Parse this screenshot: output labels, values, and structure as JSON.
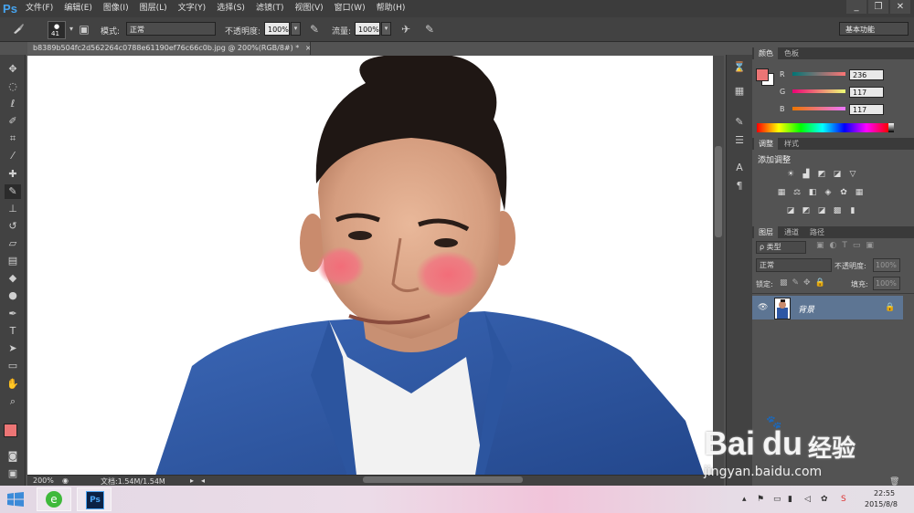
{
  "app": {
    "logo": "Ps"
  },
  "menu": [
    "文件(F)",
    "编辑(E)",
    "图像(I)",
    "图层(L)",
    "文字(Y)",
    "选择(S)",
    "滤镜(T)",
    "视图(V)",
    "窗口(W)",
    "帮助(H)"
  ],
  "window_controls": [
    "_",
    "❐",
    "✕"
  ],
  "options": {
    "brush_size": "41",
    "mode_label": "模式:",
    "mode_value": "正常",
    "opacity_label": "不透明度:",
    "opacity_value": "100%",
    "flow_label": "流量:",
    "flow_value": "100%",
    "workspace": "基本功能"
  },
  "document": {
    "tab_title": "b8389b504fc2d562264c0788e61190ef76c66c0b.jpg @ 200%(RGB/8#) *",
    "close": "×"
  },
  "status": {
    "zoom": "200%",
    "doc_info": "文档:1.54M/1.54M"
  },
  "color_panel": {
    "tabs": [
      "颜色",
      "色板"
    ],
    "r_label": "R",
    "g_label": "G",
    "b_label": "B",
    "r": "236",
    "g": "117",
    "b": "117",
    "foreground": "#ec7575",
    "background": "#ffffff"
  },
  "adjust_panel": {
    "tabs": [
      "调整",
      "样式"
    ],
    "title": "添加调整"
  },
  "layers_panel": {
    "tabs": [
      "图层",
      "通道",
      "路径"
    ],
    "filter_label": "ρ 类型",
    "blend_mode": "正常",
    "opacity_label": "不透明度:",
    "opacity_value": "100%",
    "lock_label": "锁定:",
    "fill_label": "填充:",
    "fill_value": "100%",
    "layer_name": "背景"
  },
  "watermark": {
    "brand": "Bai",
    "brand2": "du",
    "cn": "经验",
    "url": "jingyan.baidu.com"
  },
  "taskbar": {
    "time": "22:55",
    "date": "2015/8/8"
  }
}
